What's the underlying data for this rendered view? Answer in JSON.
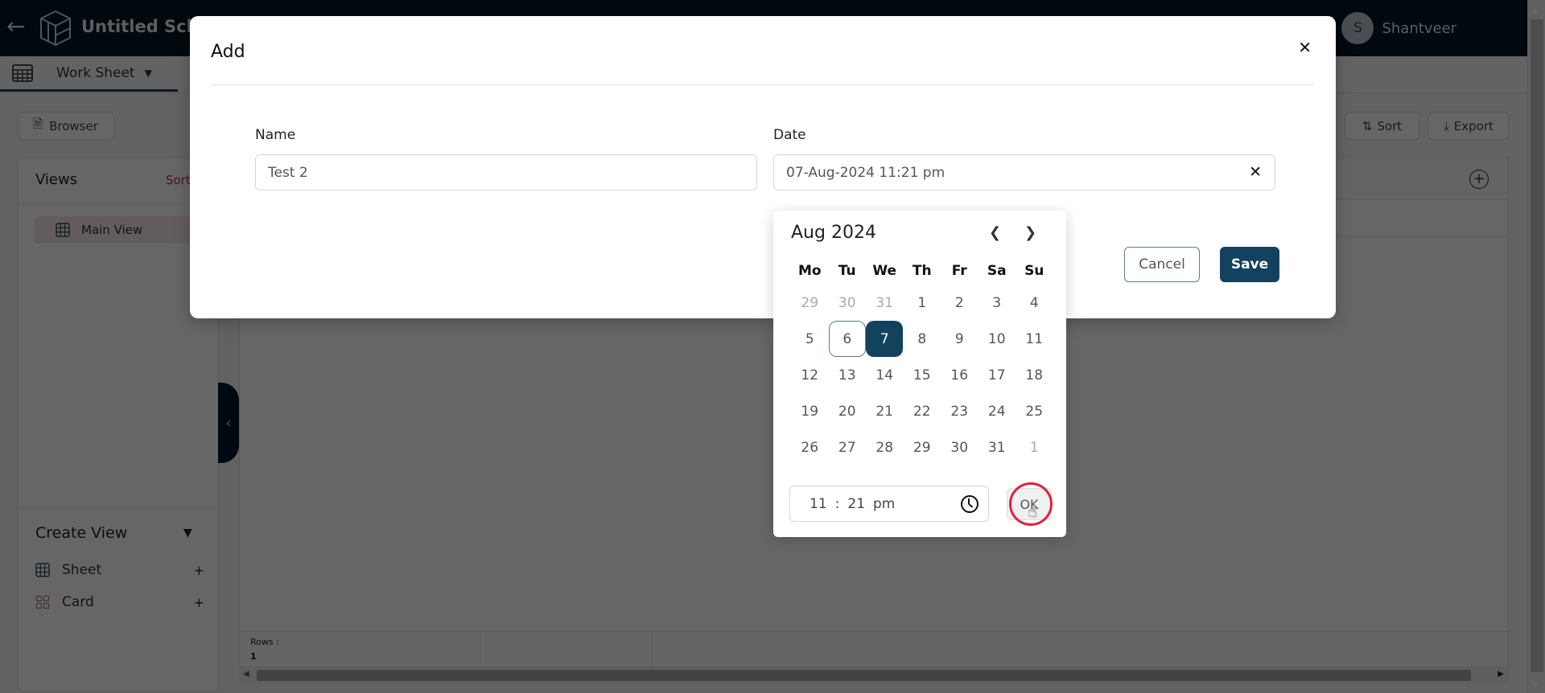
{
  "header": {
    "title": "Untitled Sche",
    "user_initial": "S",
    "user_name": "Shantveer"
  },
  "tabbar": {
    "worksheet_label": "Work Sheet"
  },
  "toolbar": {
    "browser_label": "Browser",
    "sort_label": "Sort",
    "export_label": "Export"
  },
  "sidebar": {
    "views_title": "Views",
    "views_sort": "Sort",
    "views": [
      {
        "label": "Main View"
      }
    ],
    "create_view_title": "Create View",
    "create_items": [
      {
        "label": "Sheet",
        "icon": "grid-icon"
      },
      {
        "label": "Card",
        "icon": "card-grid-icon"
      }
    ]
  },
  "grid": {
    "rows_label": "Rows :",
    "rows_value": "1"
  },
  "modal": {
    "title": "Add",
    "name_label": "Name",
    "name_value": "Test 2",
    "date_label": "Date",
    "date_value": "07-Aug-2024 11:21 pm",
    "cancel_label": "Cancel",
    "save_label": "Save"
  },
  "calendar": {
    "month_label": "Aug 2024",
    "weekdays": [
      "Mo",
      "Tu",
      "We",
      "Th",
      "Fr",
      "Sa",
      "Su"
    ],
    "days": [
      {
        "d": "29",
        "other": true
      },
      {
        "d": "30",
        "other": true
      },
      {
        "d": "31",
        "other": true
      },
      {
        "d": "1"
      },
      {
        "d": "2"
      },
      {
        "d": "3"
      },
      {
        "d": "4"
      },
      {
        "d": "5"
      },
      {
        "d": "6",
        "today": true
      },
      {
        "d": "7",
        "selected": true
      },
      {
        "d": "8"
      },
      {
        "d": "9"
      },
      {
        "d": "10"
      },
      {
        "d": "11"
      },
      {
        "d": "12"
      },
      {
        "d": "13"
      },
      {
        "d": "14"
      },
      {
        "d": "15"
      },
      {
        "d": "16"
      },
      {
        "d": "17"
      },
      {
        "d": "18"
      },
      {
        "d": "19"
      },
      {
        "d": "20"
      },
      {
        "d": "21"
      },
      {
        "d": "22"
      },
      {
        "d": "23"
      },
      {
        "d": "24"
      },
      {
        "d": "25"
      },
      {
        "d": "26"
      },
      {
        "d": "27"
      },
      {
        "d": "28"
      },
      {
        "d": "29"
      },
      {
        "d": "30"
      },
      {
        "d": "31"
      },
      {
        "d": "1",
        "other": true
      }
    ],
    "time_hour": "11",
    "time_sep": ":",
    "time_minute": "21",
    "time_ampm": "pm",
    "ok_label": "OK"
  },
  "colors": {
    "header_bg": "#011826",
    "primary": "#13425e",
    "accent_sort": "#c1334f",
    "click_highlight": "#e0203c"
  }
}
